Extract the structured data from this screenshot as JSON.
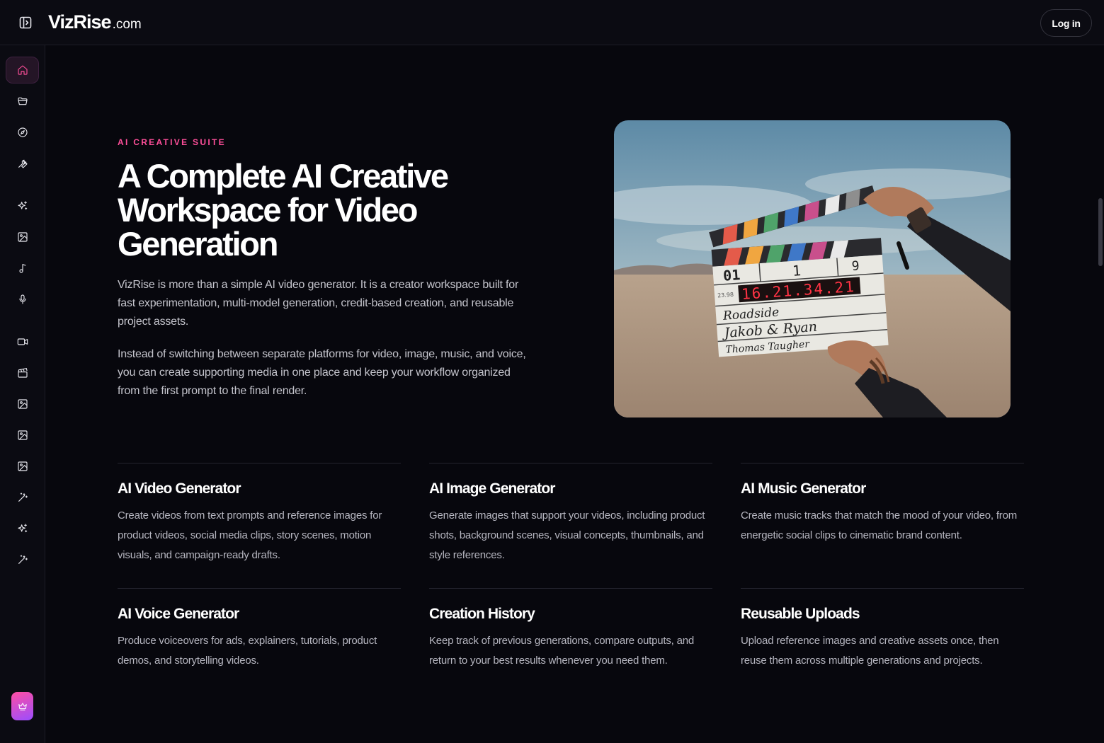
{
  "app": {
    "logo_main": "VizRise",
    "logo_tld": ".com",
    "login_label": "Log in"
  },
  "sidebar": {
    "items": [
      {
        "icon": "home-icon",
        "active": true
      },
      {
        "icon": "folder-icon"
      },
      {
        "icon": "compass-icon"
      },
      {
        "icon": "wrench-icon"
      },
      {
        "icon": "sparkles-icon"
      },
      {
        "icon": "image-icon"
      },
      {
        "icon": "music-note-icon"
      },
      {
        "icon": "microphone-icon"
      },
      {
        "icon": "video-camera-icon"
      },
      {
        "icon": "clapperboard-icon"
      },
      {
        "icon": "image-icon"
      },
      {
        "icon": "image-icon"
      },
      {
        "icon": "image-icon"
      },
      {
        "icon": "magic-wand-icon"
      },
      {
        "icon": "sparkles-icon"
      },
      {
        "icon": "magic-wand-icon"
      }
    ],
    "premium_icon": "crown-icon"
  },
  "hero": {
    "eyebrow": "AI CREATIVE SUITE",
    "title": "A Complete AI Creative Workspace for Video Generation",
    "paragraph1": "VizRise is more than a simple AI video generator. It is a creator workspace built for fast experimentation, multi-model generation, credit-based creation, and reusable project assets.",
    "paragraph2": "Instead of switching between separate platforms for video, image, music, and voice, you can create supporting media in one place and keep your workflow organized from the first prompt to the final render.",
    "image": {
      "slate_take": "01",
      "slate_scene": "1",
      "slate_roll": "9",
      "slate_fps": "23.98",
      "slate_timecode": "16.21.34.21",
      "slate_production": "Roadside",
      "slate_director": "Jakob & Ryan",
      "slate_camera": "Thomas Taugher"
    }
  },
  "features": [
    {
      "title": "AI Video Generator",
      "description": "Create videos from text prompts and reference images for product videos, social media clips, story scenes, motion visuals, and campaign-ready drafts."
    },
    {
      "title": "AI Image Generator",
      "description": "Generate images that support your videos, including product shots, background scenes, visual concepts, thumbnails, and style references."
    },
    {
      "title": "AI Music Generator",
      "description": "Create music tracks that match the mood of your video, from energetic social clips to cinematic brand content."
    },
    {
      "title": "AI Voice Generator",
      "description": "Produce voiceovers for ads, explainers, tutorials, product demos, and storytelling videos."
    },
    {
      "title": "Creation History",
      "description": "Keep track of previous generations, compare outputs, and return to your best results whenever you need them."
    },
    {
      "title": "Reusable Uploads",
      "description": "Upload reference images and creative assets once, then reuse them across multiple generations and projects."
    }
  ],
  "colors": {
    "accent": "#ff4f9a",
    "background": "#07070d",
    "panel": "#0b0b12"
  }
}
